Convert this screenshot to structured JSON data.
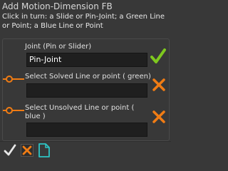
{
  "dialog": {
    "title": "Add Motion-Dimension FB",
    "instructions": "Click in turn: a Slide or Pin-Joint; a Green Line or Point; a Blue Line or Point"
  },
  "rows": [
    {
      "label": "Joint (Pin or Slider)",
      "value": "Pin-Joint",
      "status": "check-icon",
      "status_color": "#7ec81e"
    },
    {
      "label": "Select Solved Line or point ( green)",
      "value": "",
      "status": "cross-icon",
      "status_color": "#f07c14"
    },
    {
      "label": "Select Unsolved Line or point ( blue )",
      "value": "",
      "status": "cross-icon",
      "status_color": "#f07c14"
    }
  ],
  "toolbar": {
    "buttons": [
      "ok-check-icon",
      "cancel-cross-icon",
      "new-document-icon"
    ]
  },
  "colors": {
    "background": "#383838",
    "field": "#1f1f1f",
    "check": "#7ec81e",
    "cross": "#f07c14",
    "doc": "#2ec4c4"
  }
}
